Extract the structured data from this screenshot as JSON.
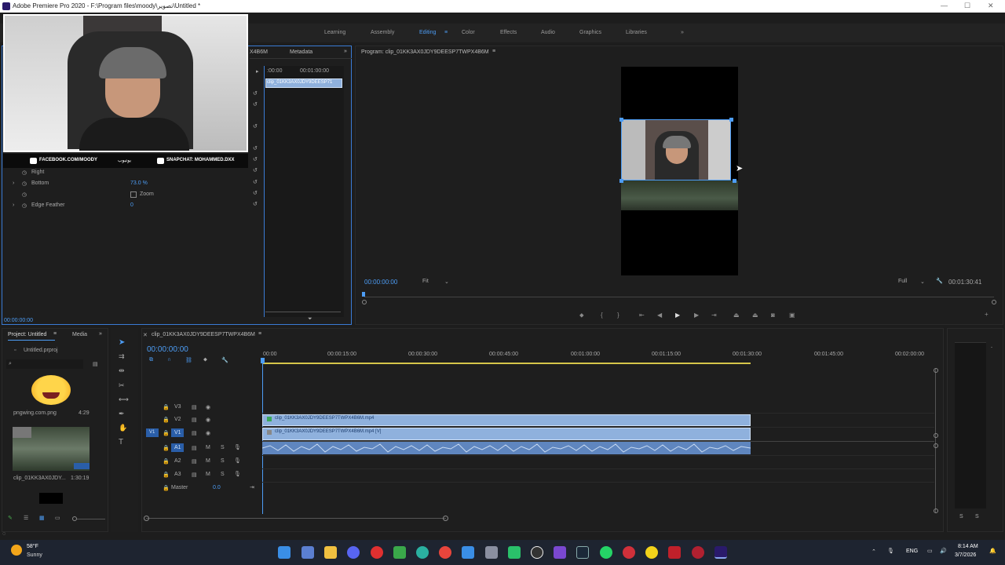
{
  "window": {
    "title": "Adobe Premiere Pro 2020 - F:\\Program files\\moody\\تصوير\\Untitled *",
    "minimize": "—",
    "maximize": "☐",
    "close": "✕"
  },
  "workspaces": {
    "items": [
      "Learning",
      "Assembly",
      "Editing",
      "Color",
      "Effects",
      "Audio",
      "Graphics",
      "Libraries"
    ],
    "active": "Editing",
    "more": "»"
  },
  "source_panel": {
    "tabs": [
      "Metadata"
    ],
    "partial_tab": "X4B6M",
    "expand": "»",
    "timecode_left": ":00:00",
    "timecode_ruler": "00:01:00:00",
    "clip_label": "clip_01KK3AX0JDY9DEESP71",
    "properties": [
      {
        "label": "Right",
        "value": ""
      },
      {
        "label": "Bottom",
        "value": "73.0 %"
      }
    ],
    "zoom_label": "Zoom",
    "edge_feather_label": "Edge Feather",
    "edge_feather_value": "0",
    "bottom_timecode": "00:00:00:00"
  },
  "webcam_banner": {
    "left": "FACEBOOK.COM/MOODY",
    "middle": "يوتيوب",
    "right": "SNAPCHAT: MOHAMMED.DXX"
  },
  "program_monitor": {
    "title": "Program: clip_01KK3AX0JDY9DEESP7TWPX4B6M",
    "timecode": "00:00:00:00",
    "fit": "Fit",
    "quality": "Full",
    "duration": "00:01:30:41",
    "transport": [
      "marker",
      "in",
      "out",
      "go-in",
      "step-back",
      "play",
      "step-forward",
      "go-out",
      "lift",
      "extract",
      "export-frame",
      "compare"
    ]
  },
  "project_panel": {
    "tab": "Project: Untitled",
    "media_tab": "Media",
    "file": "Untitled.prproj",
    "items": [
      {
        "name": "pngwing.com.png",
        "meta": "4:29"
      },
      {
        "name": "clip_01KK3AX0JDY...",
        "meta": "1:30:19"
      }
    ]
  },
  "timeline": {
    "tab": "clip_01KK3AX0JDY9DEESP7TWPX4B6M",
    "timecode": "00:00:00:00",
    "ruler": [
      "00:00",
      "00:00:15:00",
      "00:00:30:00",
      "00:00:45:00",
      "00:01:00:00",
      "00:01:15:00",
      "00:01:30:00",
      "00:01:45:00",
      "00:02:00:00"
    ],
    "tracks": [
      {
        "name": "V3",
        "type": "video"
      },
      {
        "name": "V2",
        "type": "video"
      },
      {
        "name": "V1",
        "type": "video"
      },
      {
        "name": "A1",
        "type": "audio"
      },
      {
        "name": "A2",
        "type": "audio"
      },
      {
        "name": "A3",
        "type": "audio"
      }
    ],
    "track_letters": {
      "m": "M",
      "s": "S"
    },
    "master_label": "Master",
    "master_value": "0.0",
    "clip_v2": "clip_01KK3AX0JDY9DEESP7TWPX4B6M.mp4",
    "clip_v1": "clip_01KK3AX0JDY9DEESP7TWPX4B6M.mp4 [V]",
    "clip_progress": 0.6
  },
  "taskbar": {
    "weather_temp": "58°F",
    "weather_text": "Sunny",
    "language": "ENG",
    "time": "8:14 AM",
    "date": "3/7/2026"
  },
  "colors": {
    "accent": "#4d9df5",
    "clip_video": "#8fb1dd",
    "clip_audio": "#5f86bf",
    "panel_bg": "#1e1e1e"
  }
}
